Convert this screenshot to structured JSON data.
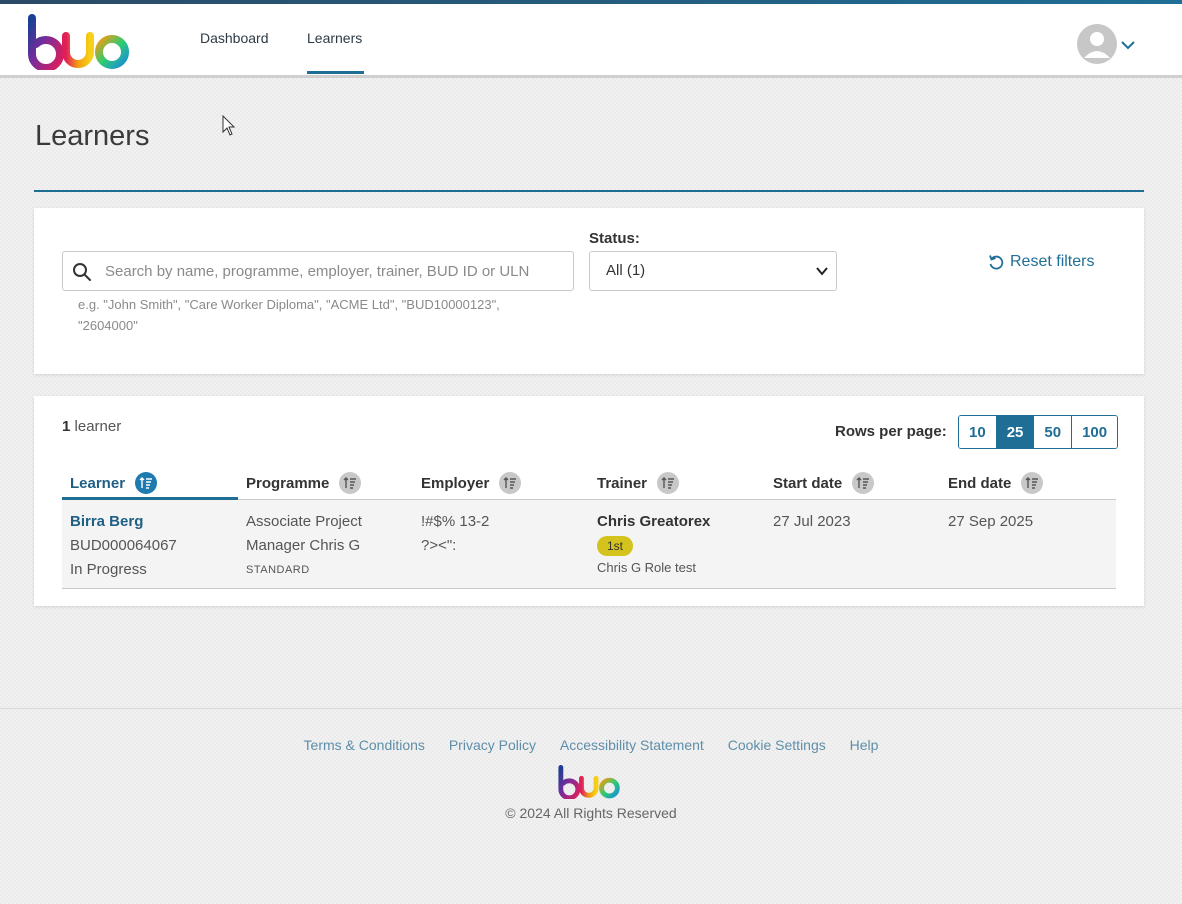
{
  "app": {
    "logo_text": "bud",
    "brand_colors": [
      "#1a3f93",
      "#e01e5a",
      "#f39c12",
      "#2ecc71"
    ]
  },
  "nav": {
    "items": [
      {
        "label": "Dashboard",
        "active": false
      },
      {
        "label": "Learners",
        "active": true
      }
    ],
    "accent": "#1f6e95"
  },
  "page": {
    "title": "Learners"
  },
  "filters": {
    "search": {
      "placeholder": "Search by name, programme, employer, trainer, BUD ID or ULN",
      "value": "",
      "hint": "e.g. \"John Smith\", \"Care Worker Diploma\", \"ACME Ltd\", \"BUD10000123\", \"2604000\""
    },
    "status": {
      "label": "Status:",
      "selected": "All (1)"
    },
    "reset_label": "Reset filters"
  },
  "results": {
    "count": "1",
    "count_label": "learner",
    "rows_per_page_label": "Rows per page:",
    "rows_per_page_options": [
      "10",
      "25",
      "50",
      "100"
    ],
    "rows_per_page_selected": "25",
    "columns": [
      "Learner",
      "Programme",
      "Employer",
      "Trainer",
      "Start date",
      "End date"
    ],
    "rows": [
      {
        "learner_name": "Birra Berg",
        "learner_id": "BUD000064067",
        "learner_status": "In Progress",
        "programme_line1": "Associate Project",
        "programme_line2": "Manager Chris G",
        "programme_type": "STANDARD",
        "employer_line1": "!#$% 13-2",
        "employer_line2": "?><\":",
        "trainer_name": "Chris Greatorex",
        "trainer_badge": "1st",
        "trainer_role": "Chris G Role test",
        "start_date": "27 Jul 2023",
        "end_date": "27 Sep 2025"
      }
    ]
  },
  "footer": {
    "links": [
      "Terms & Conditions",
      "Privacy Policy",
      "Accessibility Statement",
      "Cookie Settings",
      "Help"
    ],
    "copyright": "© 2024 All Rights Reserved"
  }
}
